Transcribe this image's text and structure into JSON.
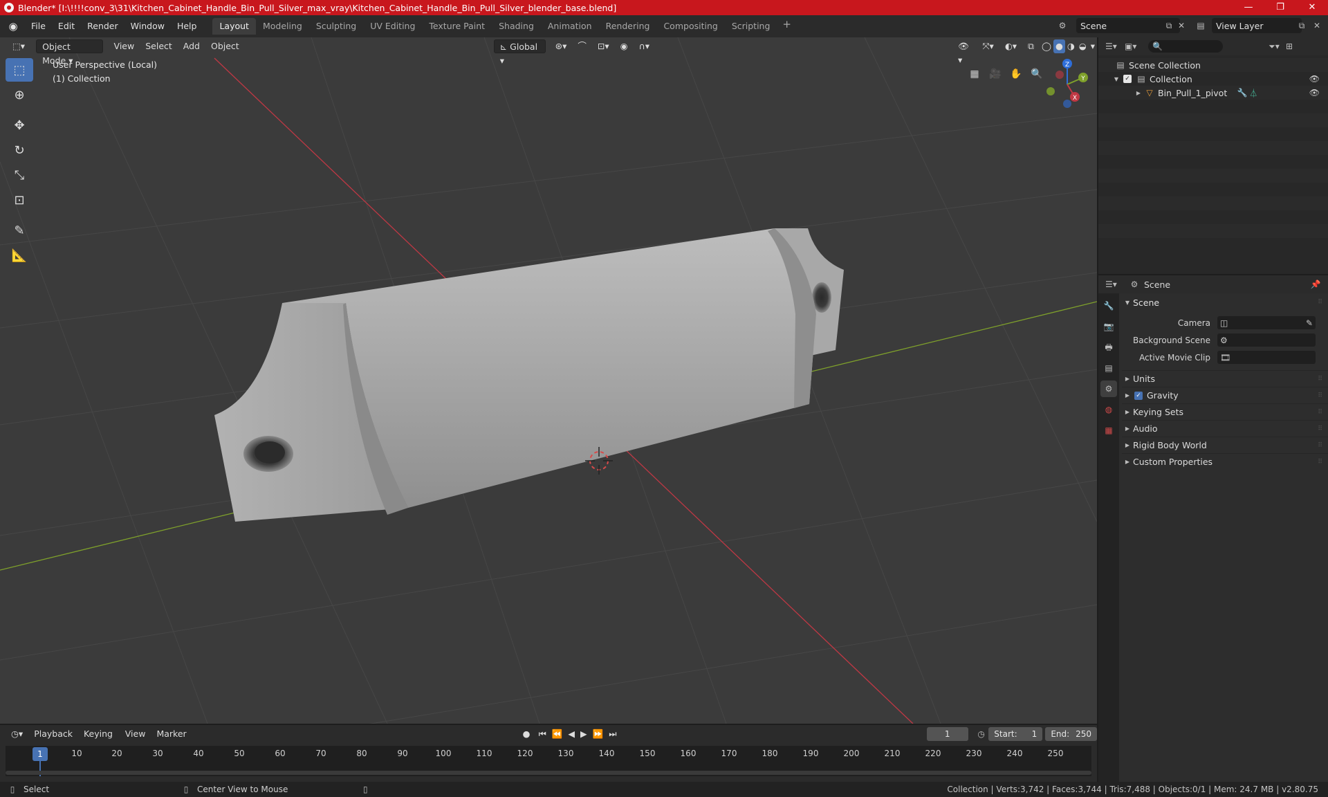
{
  "window": {
    "title": "Blender* [I:\\!!!!conv_3\\31\\Kitchen_Cabinet_Handle_Bin_Pull_Silver_max_vray\\Kitchen_Cabinet_Handle_Bin_Pull_Silver_blender_base.blend]",
    "minimize": "—",
    "maximize": "❐",
    "close": "✕"
  },
  "menu": {
    "file": "File",
    "edit": "Edit",
    "render": "Render",
    "window": "Window",
    "help": "Help"
  },
  "workspaces": [
    "Layout",
    "Modeling",
    "Sculpting",
    "UV Editing",
    "Texture Paint",
    "Shading",
    "Animation",
    "Rendering",
    "Compositing",
    "Scripting"
  ],
  "workspace_add": "+",
  "topbar": {
    "scene": "Scene",
    "view_layer": "View Layer"
  },
  "viewport": {
    "mode": "Object Mode",
    "view": "View",
    "select": "Select",
    "add": "Add",
    "object": "Object",
    "orientation": "Global",
    "info_line1": "User Perspective (Local)",
    "info_line2": "(1) Collection",
    "gizmo": {
      "x": "X",
      "y": "Y",
      "z": "Z"
    }
  },
  "colors": {
    "accent": "#4772b3",
    "title_bar": "#c8171d",
    "x_axis": "#c03844",
    "y_axis": "#7fa12b",
    "z_axis": "#2e6ed9"
  },
  "outliner": {
    "scene_collection": "Scene Collection",
    "collection": "Collection",
    "object": "Bin_Pull_1_pivot"
  },
  "properties": {
    "header_title": "Scene",
    "panel_title": "Scene",
    "camera_label": "Camera",
    "background_scene_label": "Background Scene",
    "active_movie_clip_label": "Active Movie Clip",
    "panels": [
      "Units",
      "Gravity",
      "Keying Sets",
      "Audio",
      "Rigid Body World",
      "Custom Properties"
    ]
  },
  "timeline": {
    "playback": "Playback",
    "keying": "Keying",
    "view": "View",
    "marker": "Marker",
    "current_frame": "1",
    "start_label": "Start:",
    "start_value": "1",
    "end_label": "End:",
    "end_value": "250",
    "ticks": [
      "1",
      "10",
      "20",
      "30",
      "40",
      "50",
      "60",
      "70",
      "80",
      "90",
      "100",
      "110",
      "120",
      "130",
      "140",
      "150",
      "160",
      "170",
      "180",
      "190",
      "200",
      "210",
      "220",
      "230",
      "240",
      "250"
    ]
  },
  "status": {
    "select": "Select",
    "center_view": "Center View to Mouse",
    "stats": "Collection | Verts:3,742 | Faces:3,744 | Tris:7,488 | Objects:0/1 | Mem: 24.7 MB | v2.80.75"
  }
}
